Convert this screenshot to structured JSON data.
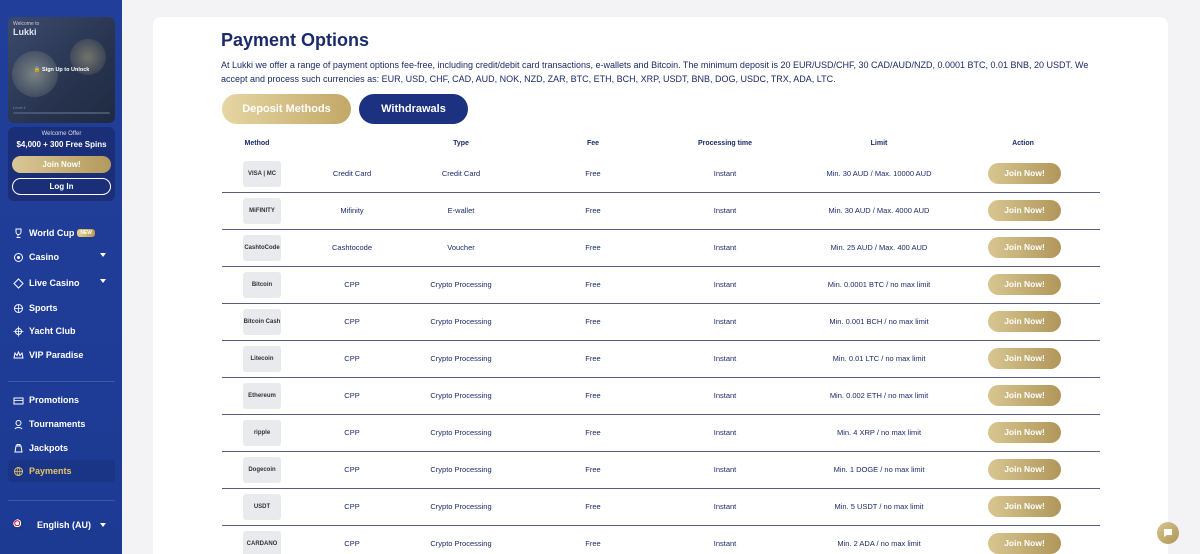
{
  "sidebar": {
    "promo": {
      "welcome": "Welcome to",
      "brand": "Lukki",
      "signup": "Sign Up to Unlock",
      "level": "Level 1"
    },
    "offer": {
      "title": "Welcome Offer",
      "amount": "$4,000 + 300 Free Spins",
      "join": "Join Now!",
      "login": "Log In"
    },
    "nav": [
      {
        "label": "World Cup",
        "icon": "trophy-icon",
        "badge": "NEW"
      },
      {
        "label": "Casino",
        "icon": "casino-chip-icon",
        "dropdown": true
      },
      {
        "label": "Live Casino",
        "icon": "live-casino-icon",
        "dropdown": true
      },
      {
        "label": "Sports",
        "icon": "sports-ball-icon"
      },
      {
        "label": "Yacht Club",
        "icon": "ship-wheel-icon"
      },
      {
        "label": "VIP Paradise",
        "icon": "crown-icon"
      }
    ],
    "nav2": [
      {
        "label": "Promotions",
        "icon": "promotions-icon"
      },
      {
        "label": "Tournaments",
        "icon": "tournament-icon"
      },
      {
        "label": "Jackpots",
        "icon": "jackpot-icon"
      },
      {
        "label": "Payments",
        "icon": "payments-icon",
        "active": true
      }
    ],
    "language": "English (AU)"
  },
  "main": {
    "title": "Payment Options",
    "description": "At Lukki we offer a range of payment options fee-free, including credit/debit card transactions, e-wallets and Bitcoin. The minimum deposit is 20 EUR/USD/CHF, 30 CAD/AUD/NZD, 0.0001 BTC, 0.01 BNB, 20 USDT. We accept and process such currencies as: EUR, USD, CHF, CAD, AUD, NOK, NZD, ZAR, BTC, ETH, BCH, XRP, USDT, BNB, DOG, USDC, TRX, ADA, LTC.",
    "tabs": {
      "deposit": "Deposit Methods",
      "withdrawals": "Withdrawals"
    },
    "columns": [
      "Method",
      "Type",
      "Fee",
      "Processing time",
      "Limit",
      "Action"
    ],
    "rows": [
      {
        "logo": "VISA | MC",
        "method": "Credit Card",
        "type": "Credit Card",
        "fee": "Free",
        "time": "Instant",
        "limit": "Min. 30 AUD / Max. 10000 AUD",
        "action": "Join Now!"
      },
      {
        "logo": "MiFINITY",
        "method": "Mifinity",
        "type": "E-wallet",
        "fee": "Free",
        "time": "Instant",
        "limit": "Min. 30 AUD / Max. 4000 AUD",
        "action": "Join Now!"
      },
      {
        "logo": "CashtoCode",
        "method": "Cashtocode",
        "type": "Voucher",
        "fee": "Free",
        "time": "Instant",
        "limit": "Min. 25 AUD / Max. 400 AUD",
        "action": "Join Now!"
      },
      {
        "logo": "Bitcoin",
        "method": "CPP",
        "type": "Crypto Processing",
        "fee": "Free",
        "time": "Instant",
        "limit": "Min. 0.0001 BTC / no max limit",
        "action": "Join Now!"
      },
      {
        "logo": "Bitcoin Cash",
        "method": "CPP",
        "type": "Crypto Processing",
        "fee": "Free",
        "time": "Instant",
        "limit": "Min. 0.001 BCH / no max limit",
        "action": "Join Now!"
      },
      {
        "logo": "Litecoin",
        "method": "CPP",
        "type": "Crypto Processing",
        "fee": "Free",
        "time": "Instant",
        "limit": "Min. 0.01 LTC / no max limit",
        "action": "Join Now!"
      },
      {
        "logo": "Ethereum",
        "method": "CPP",
        "type": "Crypto Processing",
        "fee": "Free",
        "time": "Instant",
        "limit": "Min. 0.002 ETH / no max limit",
        "action": "Join Now!"
      },
      {
        "logo": "ripple",
        "method": "CPP",
        "type": "Crypto Processing",
        "fee": "Free",
        "time": "Instant",
        "limit": "Min. 4 XRP / no max limit",
        "action": "Join Now!"
      },
      {
        "logo": "Dogecoin",
        "method": "CPP",
        "type": "Crypto Processing",
        "fee": "Free",
        "time": "Instant",
        "limit": "Min. 1 DOGE / no max limit",
        "action": "Join Now!"
      },
      {
        "logo": "USDT",
        "method": "CPP",
        "type": "Crypto Processing",
        "fee": "Free",
        "time": "Instant",
        "limit": "Min. 5 USDT / no max limit",
        "action": "Join Now!"
      },
      {
        "logo": "CARDANO",
        "method": "CPP",
        "type": "Crypto Processing",
        "fee": "Free",
        "time": "Instant",
        "limit": "Min. 2 ADA / no max limit",
        "action": "Join Now!"
      }
    ]
  },
  "colors": {
    "sidebar": "#213f9a",
    "navy": "#1b2a6b",
    "gold": "#c2a867",
    "active_text": "#e4c46b"
  }
}
